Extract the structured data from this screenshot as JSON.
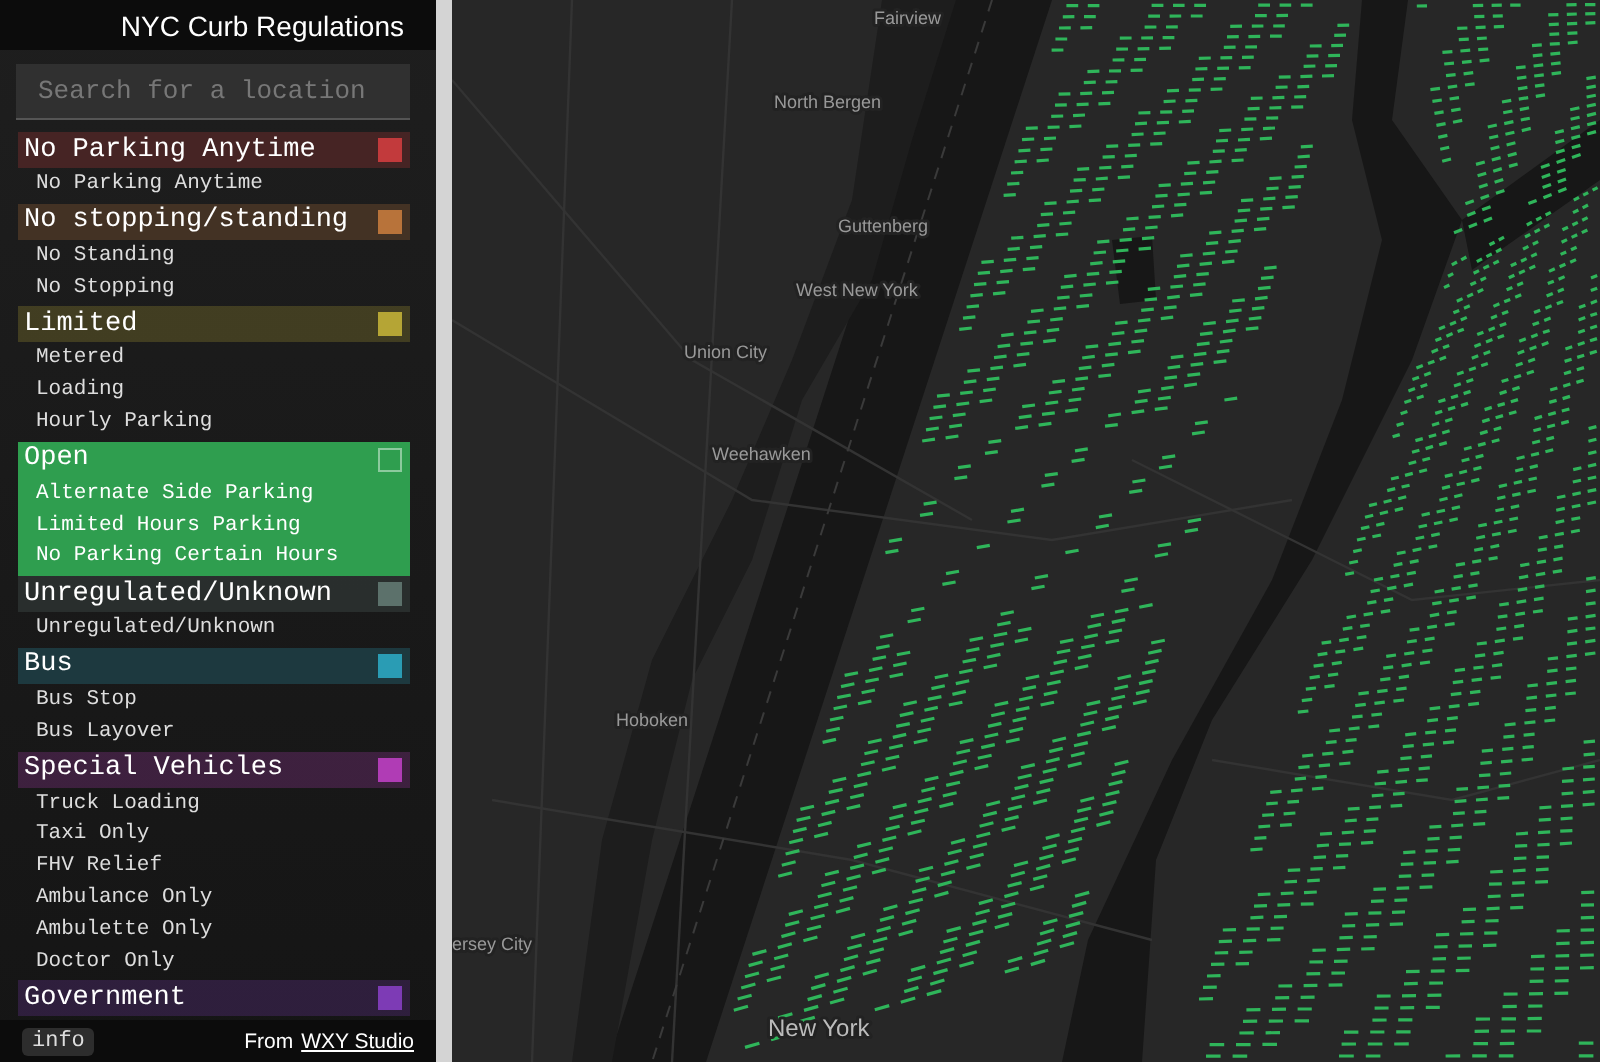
{
  "sidebar": {
    "title": "NYC Curb Regulations",
    "search": {
      "placeholder": "Search for a location"
    },
    "groups": [
      {
        "name": "No Parking Anytime",
        "color": "#c23a3c",
        "selected": false,
        "items": [
          "No Parking Anytime"
        ]
      },
      {
        "name": "No stopping/standing",
        "color": "#b8733a",
        "selected": false,
        "items": [
          "No Standing",
          "No Stopping"
        ]
      },
      {
        "name": "Limited",
        "color": "#b5a535",
        "selected": false,
        "items": [
          "Metered",
          "Loading",
          "Hourly Parking"
        ]
      },
      {
        "name": "Open",
        "color": "#2f9e4f",
        "selected": true,
        "items": [
          "Alternate Side Parking",
          "Limited Hours Parking",
          "No Parking Certain Hours"
        ]
      },
      {
        "name": "Unregulated/Unknown",
        "color": "#5c716b",
        "selected": false,
        "items": [
          "Unregulated/Unknown"
        ]
      },
      {
        "name": "Bus",
        "color": "#2a9cb4",
        "selected": false,
        "items": [
          "Bus Stop",
          "Bus Layover"
        ]
      },
      {
        "name": "Special Vehicles",
        "color": "#b03cb5",
        "selected": false,
        "items": [
          "Truck Loading",
          "Taxi Only",
          "FHV Relief",
          "Ambulance Only",
          "Ambulette Only",
          "Doctor Only"
        ]
      },
      {
        "name": "Government",
        "color": "#7d3bb5",
        "selected": false
      }
    ],
    "footer": {
      "info_button": "info",
      "credit": "From",
      "credit_link": "WXY Studio"
    }
  },
  "map": {
    "labels": [
      {
        "text": "Fairview",
        "kind": "town"
      },
      {
        "text": "North Bergen",
        "kind": "town"
      },
      {
        "text": "Guttenberg",
        "kind": "town"
      },
      {
        "text": "West New York",
        "kind": "town"
      },
      {
        "text": "Union City",
        "kind": "town"
      },
      {
        "text": "Weehawken",
        "kind": "town"
      },
      {
        "text": "Hoboken",
        "kind": "town"
      },
      {
        "text": "ersey City",
        "kind": "town"
      },
      {
        "text": "New York",
        "kind": "city"
      }
    ]
  }
}
